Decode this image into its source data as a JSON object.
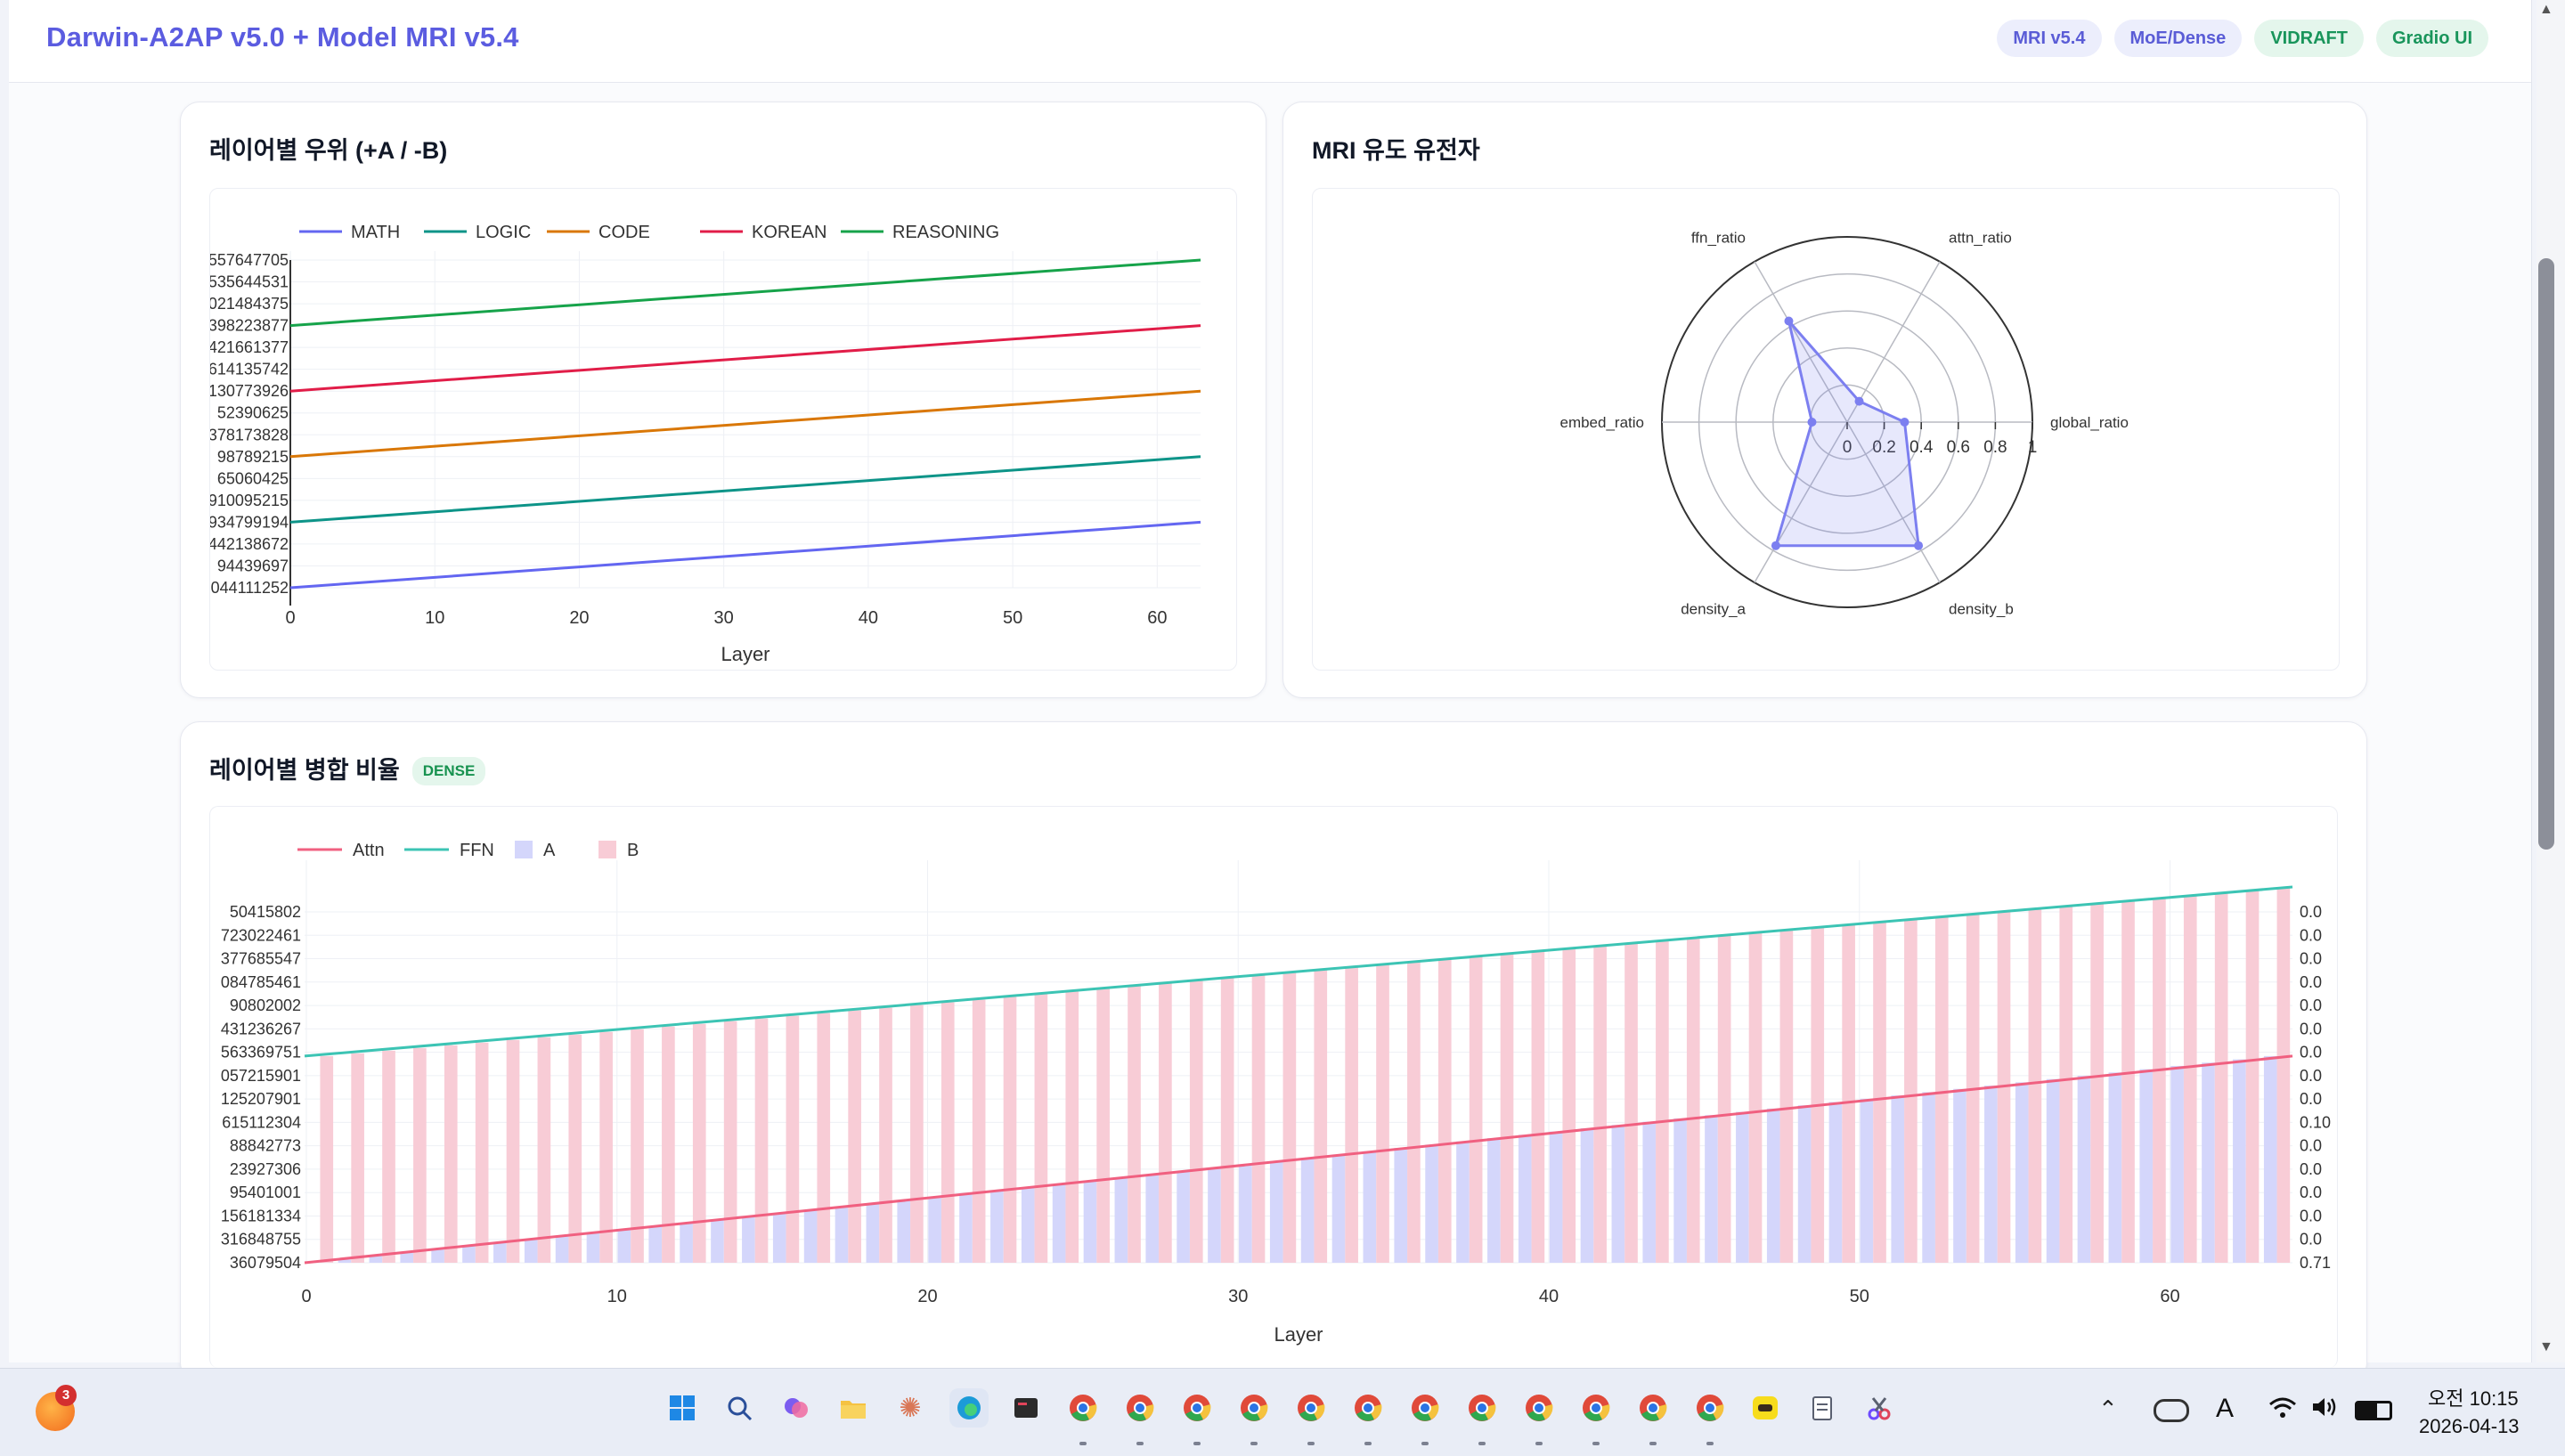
{
  "header": {
    "title": "Darwin-A2AP v5.0 + Model MRI v5.4",
    "badges": [
      "MRI v5.4",
      "MoE/Dense",
      "VIDRAFT",
      "Gradio UI"
    ]
  },
  "colors": {
    "accent": "#5b5ce0",
    "badge_green": "#19955b",
    "math": "#6366f1",
    "logic": "#0d9488",
    "code": "#d97706",
    "korean": "#e11d48",
    "reasoning": "#16a34a",
    "attn": "#f06080",
    "ffn": "#3cc4b4",
    "bar_a": "#d4d6fb",
    "bar_b": "#f8ccd6",
    "radar": "#7c7ff0"
  },
  "panels": {
    "layer_dominance": {
      "title": "레이어별 우위 (+A / -B)"
    },
    "mri_genes": {
      "title": "MRI 유도 유전자"
    },
    "merge_ratio": {
      "title": "레이어별 병합 비율",
      "tag": "DENSE"
    }
  },
  "chart_data": [
    {
      "type": "line",
      "title": "",
      "xlabel": "Layer",
      "ylabel": "",
      "xlim": [
        0,
        63
      ],
      "x_ticks": [
        "0",
        "10",
        "20",
        "30",
        "40",
        "50",
        "60"
      ],
      "y_ticks": [
        "044111252",
        "94439697",
        "442138672",
        "934799194",
        "910095215",
        "65060425",
        "98789215",
        "378173828",
        "52390625",
        "130773926",
        "614135742",
        "421661377",
        "398223877",
        "021484375",
        "535644531",
        "557647705"
      ],
      "legend": "top-left",
      "series": [
        {
          "name": "MATH",
          "x": [
            0,
            63
          ],
          "y": [
            0,
            1
          ]
        },
        {
          "name": "LOGIC",
          "x": [
            0,
            63
          ],
          "y": [
            1,
            2
          ]
        },
        {
          "name": "CODE",
          "x": [
            0,
            63
          ],
          "y": [
            2,
            3
          ]
        },
        {
          "name": "KOREAN",
          "x": [
            0,
            63
          ],
          "y": [
            3,
            4
          ]
        },
        {
          "name": "REASONING",
          "x": [
            0,
            63
          ],
          "y": [
            4,
            5
          ]
        }
      ],
      "ylim": [
        0,
        5
      ]
    },
    {
      "type": "radar",
      "axes": [
        "global_ratio",
        "attn_ratio",
        "ffn_ratio",
        "embed_ratio",
        "density_a",
        "density_b"
      ],
      "radial_ticks": [
        "0",
        "0.2",
        "0.4",
        "0.6",
        "0.8",
        "1"
      ],
      "radial_range": [
        0,
        1
      ],
      "values": [
        0.31,
        0.13,
        0.63,
        0.19,
        0.77,
        0.77
      ]
    },
    {
      "type": "bar",
      "xlabel": "Layer",
      "x_ticks": [
        "0",
        "10",
        "20",
        "30",
        "40",
        "50",
        "60"
      ],
      "y_ticks_left": [
        "36079504",
        "316848755",
        "156181334",
        "95401001",
        "23927306",
        "88842773",
        "615112304",
        "125207901",
        "057215901",
        "563369751",
        "431236267",
        "90802002",
        "084785461",
        "377685547",
        "723022461",
        "50415802"
      ],
      "y_ticks_right": [
        "0.71",
        "0.0",
        "0.0",
        "0.0",
        "0.0",
        "0.0",
        "0.10",
        "0.0",
        "0.0",
        "0.0",
        "0.0",
        "0.0",
        "0.0",
        "0.0",
        "0.0",
        "0.0"
      ],
      "legend": "top-left",
      "layers": 64,
      "series": [
        {
          "name": "Attn",
          "kind": "line",
          "x": [
            0,
            63
          ],
          "y": [
            0.0,
            0.55
          ]
        },
        {
          "name": "FFN",
          "kind": "line",
          "x": [
            0,
            63
          ],
          "y": [
            0.55,
            1.0
          ]
        },
        {
          "name": "A",
          "kind": "bar",
          "x": [
            0,
            63
          ],
          "y": [
            0.0,
            0.55
          ]
        },
        {
          "name": "B",
          "kind": "bar",
          "x": [
            0,
            63
          ],
          "y": [
            0.55,
            1.0
          ]
        }
      ],
      "ylim": [
        0,
        1
      ]
    }
  ],
  "taskbar": {
    "notification_count": "3",
    "time": "오전 10:15",
    "date": "2026-04-13",
    "tray_letter": "A"
  }
}
